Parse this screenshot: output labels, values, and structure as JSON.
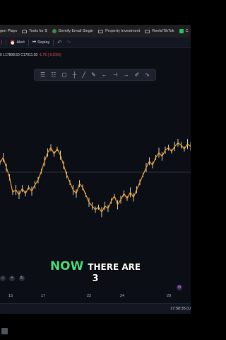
{
  "bookmarks": [
    {
      "label": "gen Plays"
    },
    {
      "label": "Tools for $"
    },
    {
      "label": "Gemify Email Singin"
    },
    {
      "label": "Property Investment"
    },
    {
      "label": "Reels/TikTok"
    },
    {
      "label": "C"
    }
  ],
  "toolbar": {
    "alert_label": "Alert",
    "replay_label": "Replay"
  },
  "ohlc": {
    "low_text": "0 L17898.50",
    "close_text": "C17911.00",
    "change_text": "-1.75 (-0.01%)"
  },
  "caption": {
    "highlight": "NOW",
    "line1_rest": "THERE ARE",
    "line2": "3"
  },
  "x_axis_labels": [
    "15",
    "17",
    "22",
    "24",
    "29"
  ],
  "status": {
    "clock": "17:58:35 (U"
  },
  "colors": {
    "candles": "#f5a623",
    "wicks": "#ffffff",
    "caption_highlight": "#4ade80",
    "down_text": "#ef5350"
  },
  "chart_data": {
    "type": "line",
    "series": [
      {
        "values": [
          0.62,
          0.66,
          0.58,
          0.5,
          0.38,
          0.4,
          0.36,
          0.41,
          0.37,
          0.42,
          0.39,
          0.44,
          0.48,
          0.55,
          0.63,
          0.7,
          0.74,
          0.69,
          0.73,
          0.68,
          0.6,
          0.52,
          0.46,
          0.4,
          0.37,
          0.45,
          0.42,
          0.36,
          0.3,
          0.27,
          0.24,
          0.26,
          0.22,
          0.27,
          0.25,
          0.31,
          0.35,
          0.28,
          0.32,
          0.37,
          0.33,
          0.38,
          0.34,
          0.4,
          0.46,
          0.52,
          0.58,
          0.63,
          0.6,
          0.66,
          0.7,
          0.67,
          0.72,
          0.74,
          0.71,
          0.75,
          0.78,
          0.76,
          0.73,
          0.77,
          0.75
        ]
      }
    ]
  }
}
